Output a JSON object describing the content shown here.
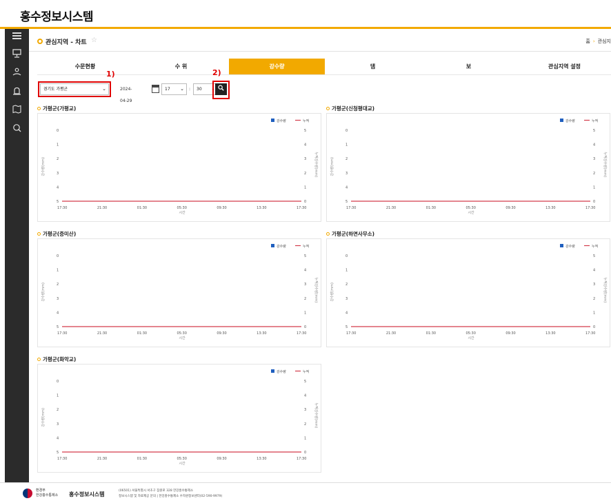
{
  "app": {
    "title": "홍수정보시스템"
  },
  "sidebar": {
    "icons": [
      "menu-icon",
      "monitor-icon",
      "water-person-icon",
      "alarm-icon",
      "map-icon",
      "search-chart-icon"
    ]
  },
  "page": {
    "title": "관심지역 - 차트",
    "breadcrumb": [
      "홈",
      "관심지"
    ]
  },
  "tabs": [
    {
      "label": "수문현황",
      "active": false
    },
    {
      "label": "수 위",
      "active": false
    },
    {
      "label": "강수량",
      "active": true
    },
    {
      "label": "댐",
      "active": false
    },
    {
      "label": "보",
      "active": false
    },
    {
      "label": "관심지역 설정",
      "active": false
    }
  ],
  "filters": {
    "region": "경기도 가평군",
    "date": "2024-04-29",
    "hour": "17",
    "colon": ":",
    "minute": "30",
    "annotation_1": "1)",
    "annotation_2": "2)"
  },
  "chart_data": [
    {
      "title": "가평군(가평교)",
      "type": "line",
      "x": [
        "17:30",
        "21:30",
        "01:30",
        "05:30",
        "09:30",
        "13:30",
        "17:30"
      ],
      "xlabel": "시간",
      "ylabel": "강수량(mm)",
      "y2label": "누적강수량(mm)",
      "left_ticks": [
        "0",
        "1",
        "2",
        "3",
        "4",
        "5"
      ],
      "right_ticks": [
        "5",
        "4",
        "3",
        "2",
        "1",
        "0"
      ],
      "legend": [
        "강수량",
        "누적"
      ],
      "series": [
        {
          "name": "강수량",
          "color": "#1f5fbf",
          "values": [
            0,
            0,
            0,
            0,
            0,
            0,
            0
          ]
        },
        {
          "name": "누적",
          "color": "#d33a4a",
          "values": [
            0,
            0,
            0,
            0,
            0,
            0,
            0
          ]
        }
      ]
    },
    {
      "title": "가평군(신청평대교)",
      "type": "line",
      "x": [
        "17:30",
        "21:30",
        "01:30",
        "05:30",
        "09:30",
        "13:30",
        "17:30"
      ],
      "xlabel": "시간",
      "ylabel": "강수량(mm)",
      "y2label": "누적강수량(mm)",
      "left_ticks": [
        "0",
        "1",
        "2",
        "3",
        "4",
        "5"
      ],
      "right_ticks": [
        "5",
        "4",
        "3",
        "2",
        "1",
        "0"
      ],
      "legend": [
        "강수량",
        "누적"
      ],
      "series": [
        {
          "name": "강수량",
          "color": "#1f5fbf",
          "values": [
            0,
            0,
            0,
            0,
            0,
            0,
            0
          ]
        },
        {
          "name": "누적",
          "color": "#d33a4a",
          "values": [
            0,
            0,
            0,
            0,
            0,
            0,
            0
          ]
        }
      ]
    },
    {
      "title": "가평군(증미산)",
      "type": "line",
      "x": [
        "17:30",
        "21:30",
        "01:30",
        "05:30",
        "09:30",
        "13:30",
        "17:30"
      ],
      "xlabel": "시간",
      "ylabel": "강수량(mm)",
      "y2label": "누적강수량(mm)",
      "left_ticks": [
        "0",
        "1",
        "2",
        "3",
        "4",
        "5"
      ],
      "right_ticks": [
        "5",
        "4",
        "3",
        "2",
        "1",
        "0"
      ],
      "legend": [
        "강수량",
        "누적"
      ],
      "series": [
        {
          "name": "강수량",
          "color": "#1f5fbf",
          "values": [
            0,
            0,
            0,
            0,
            0,
            0,
            0
          ]
        },
        {
          "name": "누적",
          "color": "#d33a4a",
          "values": [
            0,
            0,
            0,
            0,
            0,
            0,
            0
          ]
        }
      ]
    },
    {
      "title": "가평군(하면사무소)",
      "type": "line",
      "x": [
        "17:30",
        "21:30",
        "01:30",
        "05:30",
        "09:30",
        "13:30",
        "17:30"
      ],
      "xlabel": "시간",
      "ylabel": "강수량(mm)",
      "y2label": "누적강수량(mm)",
      "left_ticks": [
        "0",
        "1",
        "2",
        "3",
        "4",
        "5"
      ],
      "right_ticks": [
        "5",
        "4",
        "3",
        "2",
        "1",
        "0"
      ],
      "legend": [
        "강수량",
        "누적"
      ],
      "series": [
        {
          "name": "강수량",
          "color": "#1f5fbf",
          "values": [
            0,
            0,
            0,
            0,
            0,
            0,
            0
          ]
        },
        {
          "name": "누적",
          "color": "#d33a4a",
          "values": [
            0,
            0,
            0,
            0,
            0,
            0,
            0
          ]
        }
      ]
    },
    {
      "title": "가평군(화악교)",
      "type": "line",
      "x": [
        "17:30",
        "21:30",
        "01:30",
        "05:30",
        "09:30",
        "13:30",
        "17:30"
      ],
      "xlabel": "시간",
      "ylabel": "강수량(mm)",
      "y2label": "누적강수량(mm)",
      "left_ticks": [
        "0",
        "1",
        "2",
        "3",
        "4",
        "5"
      ],
      "right_ticks": [
        "5",
        "4",
        "3",
        "2",
        "1",
        "0"
      ],
      "legend": [
        "강수량",
        "누적"
      ],
      "series": [
        {
          "name": "강수량",
          "color": "#1f5fbf",
          "values": [
            0,
            0,
            0,
            0,
            0,
            0,
            0
          ]
        },
        {
          "name": "누적",
          "color": "#d33a4a",
          "values": [
            0,
            0,
            0,
            0,
            0,
            0,
            0
          ]
        }
      ]
    }
  ],
  "footer": {
    "org_line1": "환경부",
    "org_line2": "한강홍수통제소",
    "name": "홍수정보시스템",
    "address": "(06501) 서울특별시 서초구 잠원로 328 한강홍수통제소",
    "info": "정보시스템 및 자료제공 문의 | 한강홍수통제소 수자원정보센터(02-590-9979)"
  }
}
